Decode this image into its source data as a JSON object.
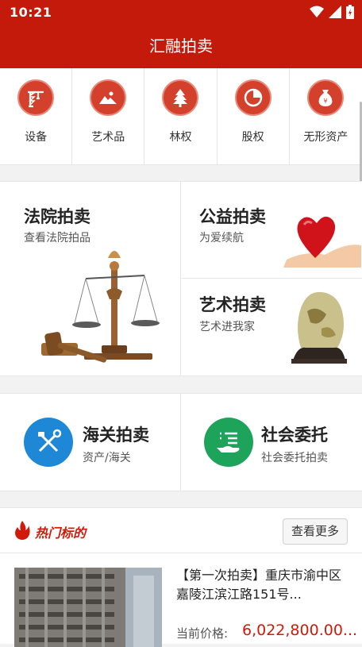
{
  "status": {
    "time": "10:21"
  },
  "header": {
    "title": "汇融拍卖"
  },
  "categories": [
    {
      "label": "设备",
      "icon": "crane-icon"
    },
    {
      "label": "艺术品",
      "icon": "painting-icon"
    },
    {
      "label": "林权",
      "icon": "tree-icon"
    },
    {
      "label": "股权",
      "icon": "pie-chart-icon"
    },
    {
      "label": "无形资产",
      "icon": "money-bag-icon"
    }
  ],
  "sections": {
    "court": {
      "title": "法院拍卖",
      "subtitle": "查看法院拍品"
    },
    "charity": {
      "title": "公益拍卖",
      "subtitle": "为爱续航"
    },
    "art": {
      "title": "艺术拍卖",
      "subtitle": "艺术进我家"
    },
    "customs": {
      "title": "海关拍卖",
      "subtitle": "资产/海关"
    },
    "entrust": {
      "title": "社会委托",
      "subtitle": "社会委托拍卖"
    }
  },
  "hot": {
    "label": "热门标的",
    "more_label": "查看更多"
  },
  "listing": {
    "title": "【第一次拍卖】重庆市渝中区嘉陵江滨江路151号...",
    "price_label": "当前价格:",
    "price": "6,022,800.00..."
  },
  "colors": {
    "brand": "#c31a0b",
    "icon_bg": "#d3402b",
    "customs_blue": "#1e87d6",
    "entrust_green": "#1ea35a",
    "price_red": "#d01a0a"
  }
}
